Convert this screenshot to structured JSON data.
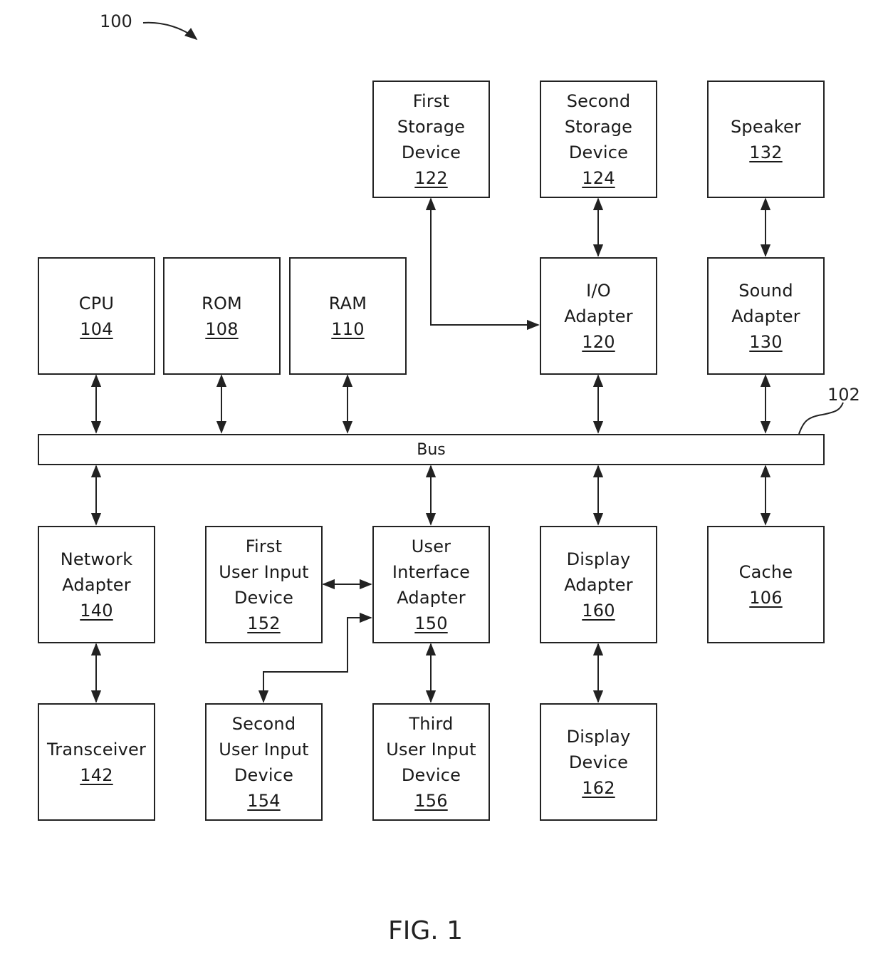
{
  "figure": {
    "caption": "FIG. 1",
    "system_ref": "100",
    "bus_ref": "102"
  },
  "bus": {
    "label": "Bus"
  },
  "blocks": {
    "first_storage": {
      "lines": [
        "First",
        "Storage",
        "Device"
      ],
      "ref": "122"
    },
    "second_storage": {
      "lines": [
        "Second",
        "Storage",
        "Device"
      ],
      "ref": "124"
    },
    "speaker": {
      "lines": [
        "Speaker"
      ],
      "ref": "132"
    },
    "cpu": {
      "lines": [
        "CPU"
      ],
      "ref": "104"
    },
    "rom": {
      "lines": [
        "ROM"
      ],
      "ref": "108"
    },
    "ram": {
      "lines": [
        "RAM"
      ],
      "ref": "110"
    },
    "io_adapter": {
      "lines": [
        "I/O",
        "Adapter"
      ],
      "ref": "120"
    },
    "sound_adapter": {
      "lines": [
        "Sound",
        "Adapter"
      ],
      "ref": "130"
    },
    "network_adapter": {
      "lines": [
        "Network",
        "Adapter"
      ],
      "ref": "140"
    },
    "first_input": {
      "lines": [
        "First",
        "User Input",
        "Device"
      ],
      "ref": "152"
    },
    "ui_adapter": {
      "lines": [
        "User",
        "Interface",
        "Adapter"
      ],
      "ref": "150"
    },
    "display_adapter": {
      "lines": [
        "Display",
        "Adapter"
      ],
      "ref": "160"
    },
    "cache": {
      "lines": [
        "Cache"
      ],
      "ref": "106"
    },
    "transceiver": {
      "lines": [
        "Transceiver"
      ],
      "ref": "142"
    },
    "second_input": {
      "lines": [
        "Second",
        "User Input",
        "Device"
      ],
      "ref": "154"
    },
    "third_input": {
      "lines": [
        "Third",
        "User Input",
        "Device"
      ],
      "ref": "156"
    },
    "display_device": {
      "lines": [
        "Display",
        "Device"
      ],
      "ref": "162"
    }
  },
  "connections": [
    [
      "first_storage",
      "io_adapter"
    ],
    [
      "second_storage",
      "io_adapter"
    ],
    [
      "speaker",
      "sound_adapter"
    ],
    [
      "cpu",
      "bus"
    ],
    [
      "rom",
      "bus"
    ],
    [
      "ram",
      "bus"
    ],
    [
      "io_adapter",
      "bus"
    ],
    [
      "sound_adapter",
      "bus"
    ],
    [
      "bus",
      "network_adapter"
    ],
    [
      "bus",
      "ui_adapter"
    ],
    [
      "bus",
      "display_adapter"
    ],
    [
      "bus",
      "cache"
    ],
    [
      "network_adapter",
      "transceiver"
    ],
    [
      "first_input",
      "ui_adapter"
    ],
    [
      "ui_adapter",
      "second_input"
    ],
    [
      "ui_adapter",
      "third_input"
    ],
    [
      "display_adapter",
      "display_device"
    ]
  ]
}
